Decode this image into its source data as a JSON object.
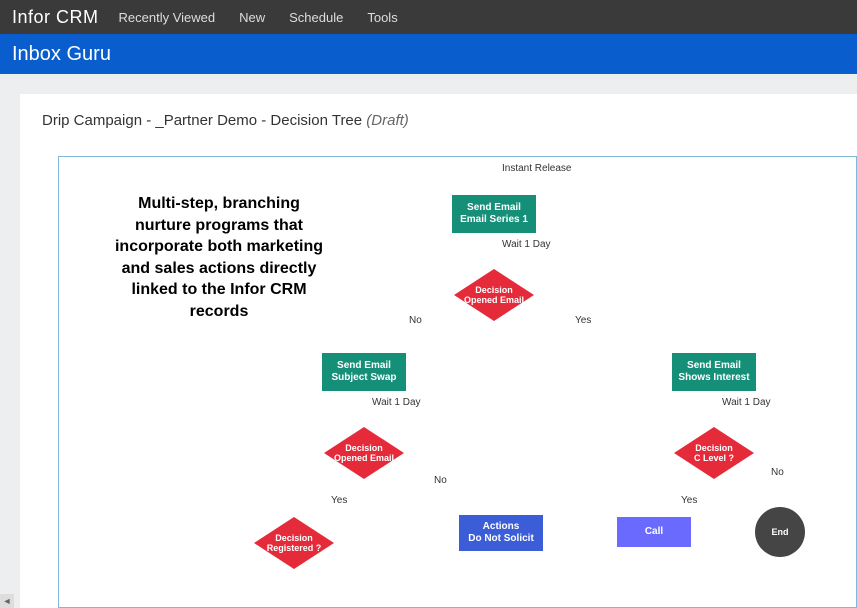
{
  "topbar": {
    "brand": "Infor CRM",
    "menu": [
      "Recently Viewed",
      "New",
      "Schedule",
      "Tools"
    ]
  },
  "titlebar": {
    "text": "Inbox Guru"
  },
  "panel": {
    "title_prefix": "Drip Campaign - _Partner Demo - Decision Tree ",
    "title_status": "(Draft)"
  },
  "annotation": "Multi-step, branching nurture programs that incorporate both marketing and sales actions directly linked to the Infor CRM records",
  "nodes": {
    "release": "Instant Release",
    "email1_l1": "Send Email",
    "email1_l2": "Email Series 1",
    "wait1": "Wait 1 Day",
    "dec1_l1": "Decision",
    "dec1_l2": "Opened Email",
    "no1": "No",
    "yes1": "Yes",
    "email2_l1": "Send Email",
    "email2_l2": "Subject Swap",
    "email3_l1": "Send Email",
    "email3_l2": "Shows Interest",
    "wait2a": "Wait 1 Day",
    "wait2b": "Wait 1 Day",
    "dec2_l1": "Decision",
    "dec2_l2": "Opened Email",
    "dec3_l1": "Decision",
    "dec3_l2": "C Level ?",
    "yes2": "Yes",
    "no2": "No",
    "yes3": "Yes",
    "no3": "No",
    "dec4_l1": "Decision",
    "dec4_l2": "Registered ?",
    "action_l1": "Actions",
    "action_l2": "Do Not Solicit",
    "call": "Call",
    "end": "End"
  },
  "colors": {
    "email": "#168f78",
    "decision": "#e52a3a",
    "action": "#3b5dd8",
    "call": "#6a6aff",
    "end": "#454545"
  }
}
